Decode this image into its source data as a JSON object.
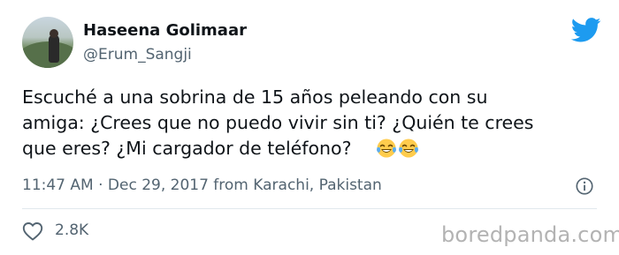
{
  "author": {
    "name": "Haseena Golimaar",
    "handle": "@Erum_Sangji"
  },
  "tweet": {
    "lines": [
      "Escuché a una sobrina de 15 años peleando con su",
      "amiga: ¿Crees que no puedo vivir sin ti? ¿Quién te crees",
      "que eres? ¿Mi cargador de teléfono?"
    ],
    "emojis": [
      "face-with-tears-of-joy",
      "face-with-tears-of-joy"
    ]
  },
  "meta": {
    "timestamp": "11:47 AM · Dec 29, 2017 from Karachi, Pakistan"
  },
  "engagement": {
    "likes": "2.8K"
  },
  "watermark": "boredpanda.com",
  "colors": {
    "twitter_blue": "#1d9bf0",
    "secondary_text": "#536471",
    "primary_text": "#0f1419"
  },
  "icons": {
    "brand": "twitter-bird-icon",
    "info": "info-icon",
    "like": "heart-icon"
  }
}
